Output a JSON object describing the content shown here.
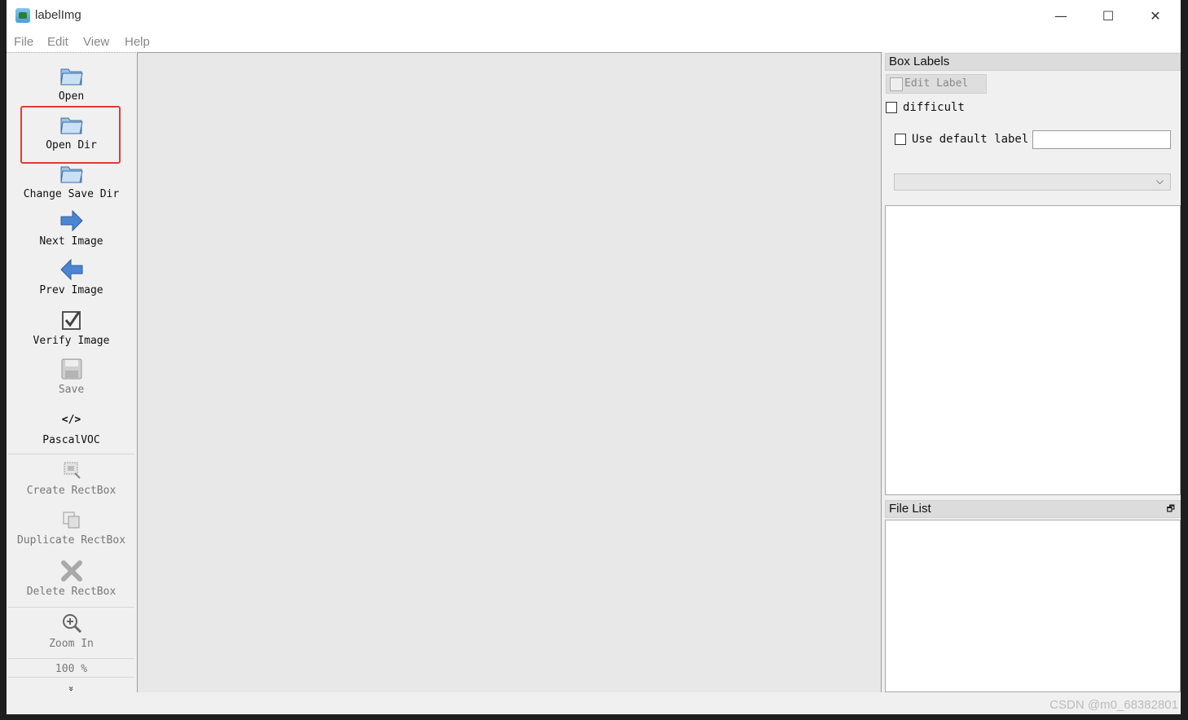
{
  "window": {
    "title": "labelImg",
    "controls": {
      "minimize": "—",
      "maximize": "☐",
      "close": "✕"
    }
  },
  "menu": [
    "File",
    "Edit",
    "View",
    "Help"
  ],
  "toolbar": {
    "open": "Open",
    "open_dir": "Open Dir",
    "change_save_dir": "Change Save Dir",
    "next_image": "Next Image",
    "prev_image": "Prev Image",
    "verify_image": "Verify Image",
    "save": "Save",
    "format_icon": "</>",
    "format": "PascalVOC",
    "create_rectbox": "Create RectBox",
    "duplicate_rectbox": "Duplicate RectBox",
    "delete_rectbox": "Delete RectBox",
    "zoom_in": "Zoom In",
    "zoom_level": "100 %",
    "more": "»"
  },
  "box_labels": {
    "title": "Box Labels",
    "edit_label": "Edit Label",
    "difficult": "difficult",
    "use_default_label": "Use default label",
    "default_label_value": ""
  },
  "file_list": {
    "title": "File List",
    "float_icon": "🗗"
  },
  "watermark": "CSDN @m0_68382801",
  "colors": {
    "highlight": "#e53935",
    "canvas": "#e8e8e8"
  }
}
